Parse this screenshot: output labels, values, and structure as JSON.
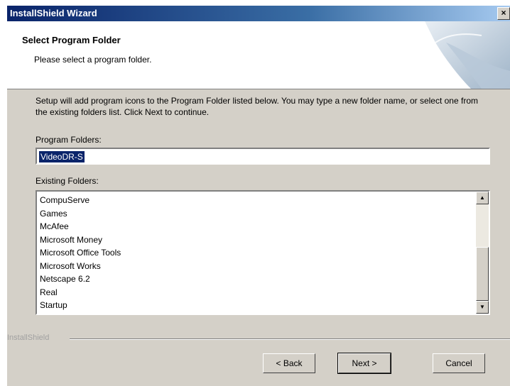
{
  "window": {
    "title": "InstallShield Wizard",
    "close_glyph": "×"
  },
  "header": {
    "title": "Select Program Folder",
    "subtitle": "Please select a program folder."
  },
  "instructions": "Setup will add program icons to the Program Folder listed below.  You may type a new folder name, or select one from the existing folders list.  Click Next to continue.",
  "program_folder": {
    "label": "Program Folders:",
    "value": "VideoDR-S"
  },
  "existing_folders": {
    "label": "Existing Folders:",
    "items": [
      "CompuServe",
      "Games",
      "McAfee",
      "Microsoft Money",
      "Microsoft Office Tools",
      "Microsoft Works",
      "Netscape 6.2",
      "Real",
      "Startup"
    ],
    "scroll_position": 0.85
  },
  "branding": "InstallShield",
  "buttons": {
    "back": "< Back",
    "next": "Next >",
    "cancel": "Cancel"
  },
  "icons": {
    "close": "close-icon",
    "scroll_up": "scroll-up-arrow-icon",
    "scroll_down": "scroll-down-arrow-icon"
  },
  "colors": {
    "titlebar_start": "#0a246a",
    "titlebar_end": "#a6caf0",
    "face": "#d4d0c8",
    "selection": "#0a246a"
  }
}
